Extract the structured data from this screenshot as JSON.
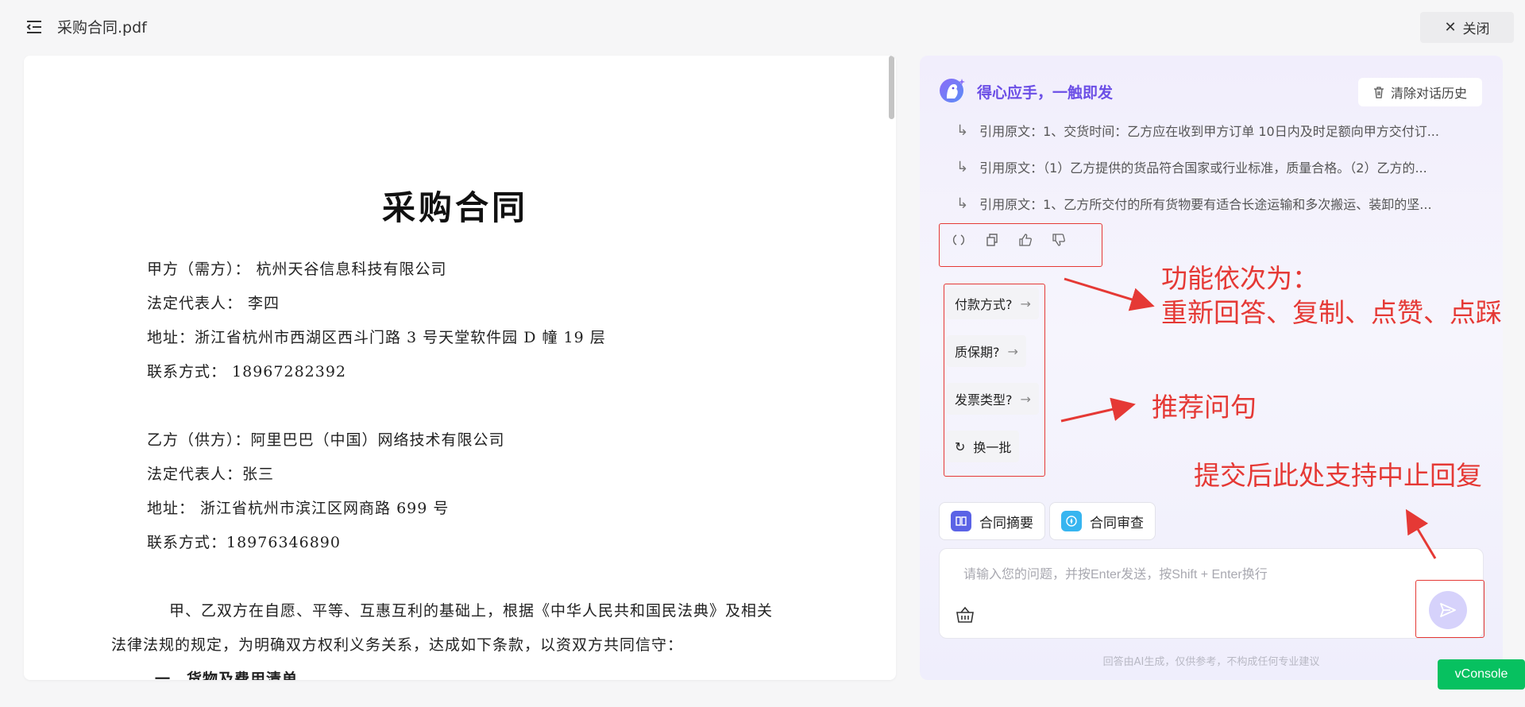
{
  "header": {
    "file_name": "采购合同.pdf",
    "close_label": "关闭"
  },
  "document": {
    "title": "采购合同",
    "lines": [
      "甲方（需方）： 杭州天谷信息科技有限公司",
      "法定代表人：    李四",
      "地址：浙江省杭州市西湖区西斗门路 3 号天堂软件园 D 幢 19 层",
      "联系方式： 18967282392",
      "乙方（供方）：阿里巴巴（中国）网络技术有限公司",
      "法定代表人：张三",
      "地址：  浙江省杭州市滨江区网商路 699 号",
      "联系方式：18976346890",
      "甲、乙双方在自愿、平等、互惠互利的基础上，根据《中华人民共和国民法典》及相关",
      "法律法规的规定，为明确双方权利义务关系，达成如下条款，以资双方共同信守：",
      "一、货物及费用清单"
    ]
  },
  "chat": {
    "brand": "得心应手，一触即发",
    "clear_label": "清除对话历史",
    "citations": [
      "引用原文：1、交货时间：乙方应在收到甲方订单 10日内及时足额向甲方交付订...",
      "引用原文：（1）乙方提供的货品符合国家或行业标准，质量合格。（2）乙方的...",
      "引用原文：1、乙方所交付的所有货物要有适合长途运输和多次搬运、装卸的坚..."
    ],
    "suggestions": [
      "付款方式?",
      "质保期?",
      "发票类型?"
    ],
    "refresh_label": "换一批",
    "tools": [
      "合同摘要",
      "合同审查"
    ],
    "input_placeholder": "请输入您的问题，并按Enter发送，按Shift + Enter换行",
    "disclaimer": "回答由AI生成，仅供参考，不构成任何专业建议"
  },
  "annotations": {
    "actions_line1": "功能依次为：",
    "actions_line2": "重新回答、复制、点赞、点踩",
    "suggestions": "推荐问句",
    "send": "提交后此处支持中止回复"
  },
  "vconsole_label": "vConsole",
  "colors": {
    "brand": "#6b4ee6",
    "annotation_red": "#e53935",
    "vconsole_green": "#07c160",
    "send_button": "#d6d2fb"
  }
}
